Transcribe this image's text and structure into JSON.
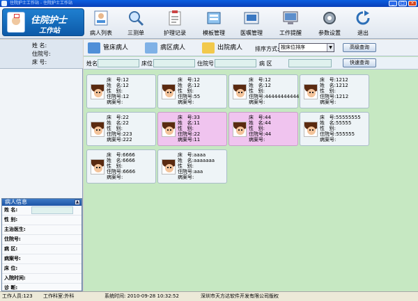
{
  "window": {
    "title": "住院护士工作站 - 住院护士工作站"
  },
  "logo": {
    "line1": "住院护士",
    "line2": "工作站"
  },
  "toolbar": [
    {
      "label": "病人列表",
      "icon": "patient-list-icon"
    },
    {
      "label": "三测单",
      "icon": "magnifier-icon"
    },
    {
      "label": "护理记录",
      "icon": "nursing-record-icon"
    },
    {
      "label": "模板管理",
      "icon": "template-icon"
    },
    {
      "label": "医嘱管理",
      "icon": "medical-order-icon"
    },
    {
      "label": "工作提醒",
      "icon": "monitor-icon"
    },
    {
      "label": "参数设置",
      "icon": "settings-icon"
    },
    {
      "label": "退出",
      "icon": "exit-icon"
    }
  ],
  "patient_summary": {
    "name_label": "姓  名:",
    "admission_label": "住院号:",
    "bed_label": "床  号:"
  },
  "tabs": [
    {
      "label": "管床病人"
    },
    {
      "label": "病区病人"
    },
    {
      "label": "出院病人"
    }
  ],
  "sort": {
    "label": "排序方式:",
    "value": "按床位排序"
  },
  "buttons": {
    "advanced_search": "高级查询",
    "quick_search": "快速查询"
  },
  "filters": {
    "name": "姓名",
    "bed": "床位",
    "admission": "住院号",
    "ward": "病  区"
  },
  "info_panel": {
    "title": "病人信息",
    "rows": [
      "姓  名:",
      "性  别:",
      "主治医生:",
      "住院号:",
      "病  区:",
      "病案号:",
      "床  位:",
      "入院时间:",
      "诊  断:"
    ]
  },
  "cards": [
    {
      "text": "床   号:12\n姓   名:12\n性   别:\n住院号:12\n病案号:",
      "highlight": false
    },
    {
      "text": "床   号:12\n姓   名:12\n性   别:\n住院号:55\n病案号:",
      "highlight": false
    },
    {
      "text": "床   号:12\n姓   名:12\n性   别:\n住院号:44444444444\n病案号:",
      "highlight": false
    },
    {
      "text": "床   号:1212\n姓   名:1212\n性   别:\n住院号:1212\n病案号:",
      "highlight": false
    },
    {
      "text": "床   号:22\n姓   名:22\n性   别:\n住院号:223\n病案号:222",
      "highlight": false
    },
    {
      "text": "床   号:33\n姓   名:11\n性   别:\n住院号:22\n病案号:11",
      "highlight": true
    },
    {
      "text": "床   号:44\n姓   名:44\n性   别:\n住院号:44\n病案号:",
      "highlight": true
    },
    {
      "text": "床   号:55555555\n姓   名:55555\n性   别:\n住院号:555555\n病案号:",
      "highlight": false
    },
    {
      "text": "床   号:6666\n姓   名:6666\n性   别:\n住院号:6666\n病案号:",
      "highlight": false
    },
    {
      "text": "床   号:aaaa\n姓   名:aaaaaaa\n性   别:\n住院号:aaa\n病案号:",
      "highlight": false
    }
  ],
  "status": {
    "staff": "工作人员:123",
    "department": "工作科室:外科",
    "time": "系统时间: 2010-09-28 10:32:52",
    "copyright": "深圳市天方达软件开发有限公司版权"
  },
  "colors": {
    "content_bg": "#c6e8c2",
    "card_highlight": "#f0c4ef",
    "title_blue": "#0b5fe0"
  }
}
